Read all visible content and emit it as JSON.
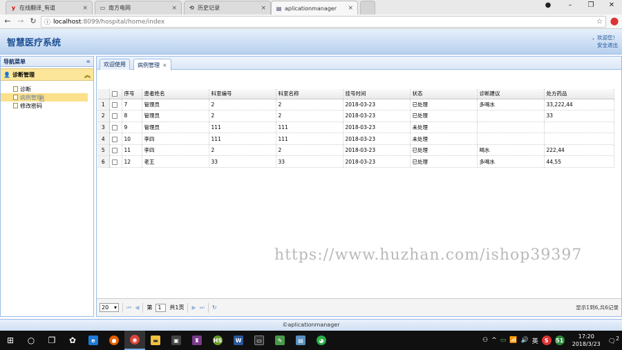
{
  "browser": {
    "tabs": [
      {
        "title": "在线翻译_有道",
        "favicon": "y"
      },
      {
        "title": "南方电网",
        "favicon": "doc-icon"
      },
      {
        "title": "历史记录",
        "favicon": "history-icon"
      },
      {
        "title": "aplicationmanager",
        "favicon": "doc-icon"
      }
    ],
    "url_host": "localhost",
    "url_path": ":8099/hospital/home/index"
  },
  "app": {
    "title": "智慧医疗系统",
    "welcome": "，欢迎您！",
    "logout": "安全退出"
  },
  "sidebar": {
    "title": "导航菜单",
    "section": "诊断管理",
    "items": [
      {
        "label": "诊断"
      },
      {
        "label": "病例管理"
      },
      {
        "label": "修改密码"
      }
    ]
  },
  "main": {
    "tabs": [
      {
        "label": "欢迎使用"
      },
      {
        "label": "病例管理"
      }
    ],
    "columns": [
      "序号",
      "患者姓名",
      "科室编号",
      "科室名称",
      "挂号时间",
      "状态",
      "诊断建议",
      "处方药品"
    ],
    "rows": [
      {
        "n": "1",
        "c": [
          "7",
          "管理员",
          "2",
          "2",
          "2018-03-23",
          "已处理",
          "多喝水",
          "33,222,44"
        ]
      },
      {
        "n": "2",
        "c": [
          "8",
          "管理员",
          "2",
          "2",
          "2018-03-23",
          "已处理",
          "",
          "33"
        ]
      },
      {
        "n": "3",
        "c": [
          "9",
          "管理员",
          "111",
          "111",
          "2018-03-23",
          "未处理",
          "",
          ""
        ]
      },
      {
        "n": "4",
        "c": [
          "10",
          "李四",
          "111",
          "111",
          "2018-03-23",
          "未处理",
          "",
          ""
        ]
      },
      {
        "n": "5",
        "c": [
          "11",
          "李四",
          "2",
          "2",
          "2018-03-23",
          "已处理",
          "喝水",
          "222,44"
        ]
      },
      {
        "n": "6",
        "c": [
          "12",
          "老王",
          "33",
          "33",
          "2018-03-23",
          "已处理",
          "多喝水",
          "44,55"
        ]
      }
    ],
    "pager": {
      "page_size": "20",
      "page_prefix": "第",
      "page_value": "1",
      "page_suffix": "共1页",
      "info": "显示1到6,共6记录"
    }
  },
  "footer": "©aplicationmanager",
  "watermark": "https://www.huzhan.com/ishop39397",
  "taskbar": {
    "time": "17:20",
    "date": "2018/3/23",
    "ime": "英",
    "notifications": "2"
  },
  "colors": {
    "accent": "#99bbe8",
    "header_text": "#1c4f93",
    "selected": "#fbe18c"
  }
}
